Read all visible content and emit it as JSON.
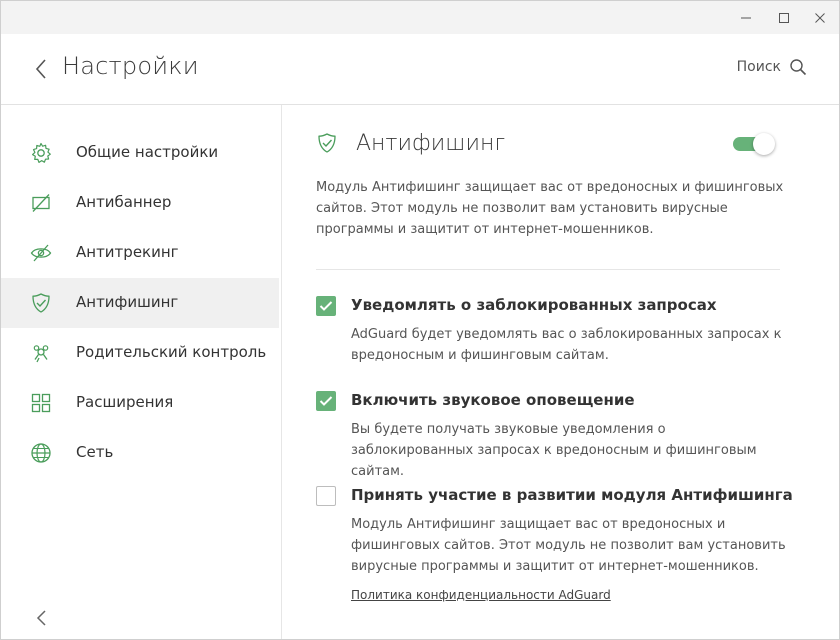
{
  "window": {
    "controls": [
      "minimize-icon",
      "maximize-icon",
      "close-icon"
    ]
  },
  "header": {
    "title": "Настройки",
    "search_label": "Поиск"
  },
  "sidebar": {
    "items": [
      {
        "label": "Общие настройки",
        "icon": "gear-icon"
      },
      {
        "label": "Антибаннер",
        "icon": "ad-block-icon"
      },
      {
        "label": "Антитрекинг",
        "icon": "eye-crossed-icon"
      },
      {
        "label": "Антифишинг",
        "icon": "shield-check-icon",
        "active": true
      },
      {
        "label": "Родительский контроль",
        "icon": "parental-control-icon"
      },
      {
        "label": "Расширения",
        "icon": "extensions-grid-icon"
      },
      {
        "label": "Сеть",
        "icon": "globe-icon"
      }
    ]
  },
  "main": {
    "title": "Антифишинг",
    "enabled": true,
    "description": "Модуль Антифишинг защищает вас от вредоносных и фишинговых сайтов. Этот модуль не позволит вам установить вирусные программы и защитит от интернет-мошенников.",
    "options": [
      {
        "checked": true,
        "title": "Уведомлять о заблокированных запросах",
        "description": "AdGuard будет уведомлять вас о заблокированных запросах к вредоносным и фишинговым сайтам."
      },
      {
        "checked": true,
        "title": "Включить звуковое оповещение",
        "description": "Вы будете получать звуковые уведомления о заблокированных запросах к вредоносным и фишинговым сайтам."
      },
      {
        "checked": false,
        "title": "Принять участие в развитии модуля Антифишинга",
        "description": "Модуль Антифишинг защищает вас от вредоносных и фишинговых сайтов. Этот модуль не позволит вам установить вирусные программы и защитит от интернет-мошенников."
      }
    ],
    "privacy_link": "Политика конфиденциальности AdGuard"
  },
  "colors": {
    "accent": "#67b279",
    "icon_green": "#4a9d5b"
  }
}
